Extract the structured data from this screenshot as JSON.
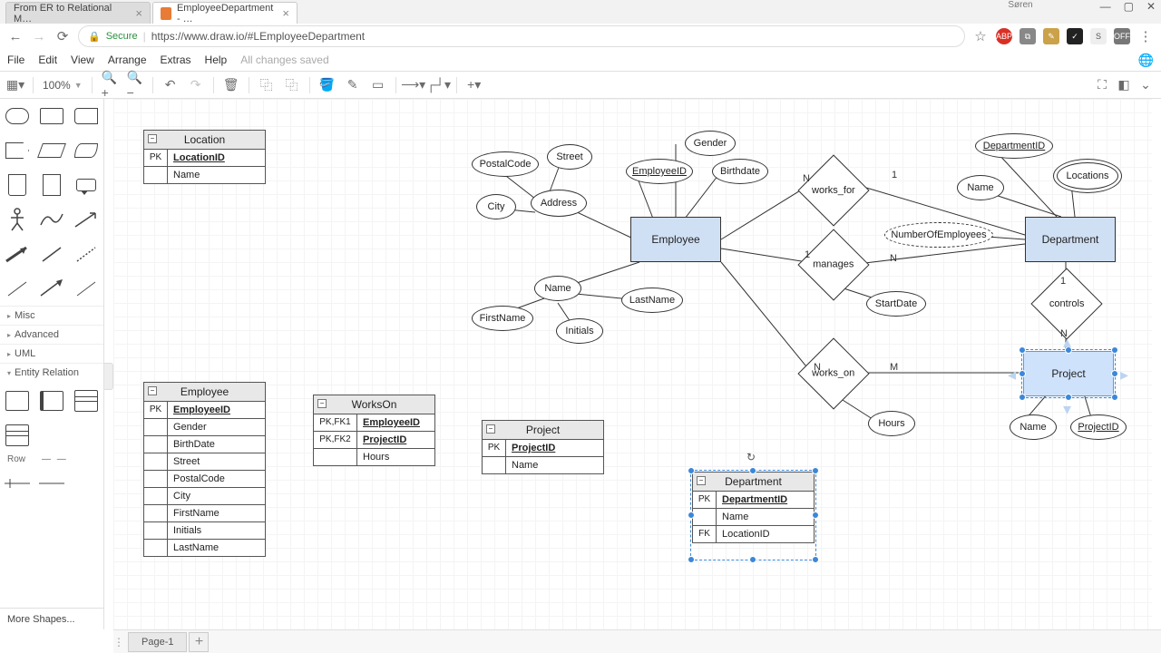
{
  "browser": {
    "tabs": [
      {
        "title": "From ER to Relational M…"
      },
      {
        "title": "EmployeeDepartment - …"
      }
    ],
    "user": "Søren",
    "nav": {
      "secure": "Secure",
      "url": "https://www.draw.io/#LEmployeeDepartment"
    }
  },
  "menubar": {
    "items": [
      "File",
      "Edit",
      "View",
      "Arrange",
      "Extras",
      "Help"
    ],
    "status": "All changes saved"
  },
  "toolbar": {
    "zoom": "100%"
  },
  "sidebar": {
    "sections": [
      "Misc",
      "Advanced",
      "UML",
      "Entity Relation"
    ],
    "row_label": "Row",
    "more": "More Shapes..."
  },
  "pages": {
    "tab": "Page-1"
  },
  "tables": {
    "location": {
      "title": "Location",
      "rows": [
        {
          "k": "PK",
          "v": "LocationID",
          "pk": true
        },
        {
          "k": "",
          "v": "Name"
        }
      ]
    },
    "employee": {
      "title": "Employee",
      "rows": [
        {
          "k": "PK",
          "v": "EmployeeID",
          "pk": true
        },
        {
          "k": "",
          "v": "Gender"
        },
        {
          "k": "",
          "v": "BirthDate"
        },
        {
          "k": "",
          "v": "Street"
        },
        {
          "k": "",
          "v": "PostalCode"
        },
        {
          "k": "",
          "v": "City"
        },
        {
          "k": "",
          "v": "FirstName"
        },
        {
          "k": "",
          "v": "Initials"
        },
        {
          "k": "",
          "v": "LastName"
        }
      ]
    },
    "workson": {
      "title": "WorksOn",
      "rows": [
        {
          "k": "PK,FK1",
          "v": "EmployeeID",
          "pk": true
        },
        {
          "k": "PK,FK2",
          "v": "ProjectID",
          "pk": true
        },
        {
          "k": "",
          "v": "Hours"
        }
      ]
    },
    "project": {
      "title": "Project",
      "rows": [
        {
          "k": "PK",
          "v": "ProjectID",
          "pk": true
        },
        {
          "k": "",
          "v": "Name"
        }
      ]
    },
    "department": {
      "title": "Department",
      "rows": [
        {
          "k": "PK",
          "v": "DepartmentID",
          "pk": true
        },
        {
          "k": "",
          "v": "Name"
        },
        {
          "k": "FK",
          "v": "LocationID"
        }
      ]
    }
  },
  "er": {
    "entities": {
      "employee": "Employee",
      "department": "Department",
      "project": "Project"
    },
    "relationships": {
      "works_for": "works_for",
      "manages": "manages",
      "controls": "controls",
      "works_on": "works_on"
    },
    "attributes": {
      "gender": "Gender",
      "birthdate": "Birthdate",
      "employeeid": "EmployeeID",
      "address": "Address",
      "street": "Street",
      "postalcode": "PostalCode",
      "city": "City",
      "name_emp": "Name",
      "firstname": "FirstName",
      "lastname": "LastName",
      "initials": "Initials",
      "departmentid": "DepartmentID",
      "name_dept": "Name",
      "locations": "Locations",
      "numberofemployees": "NumberOfEmployees",
      "startdate": "StartDate",
      "hours": "Hours",
      "name_proj": "Name",
      "projectid": "ProjectID"
    },
    "cardinality": {
      "n": "N",
      "m": "M",
      "one": "1"
    }
  }
}
